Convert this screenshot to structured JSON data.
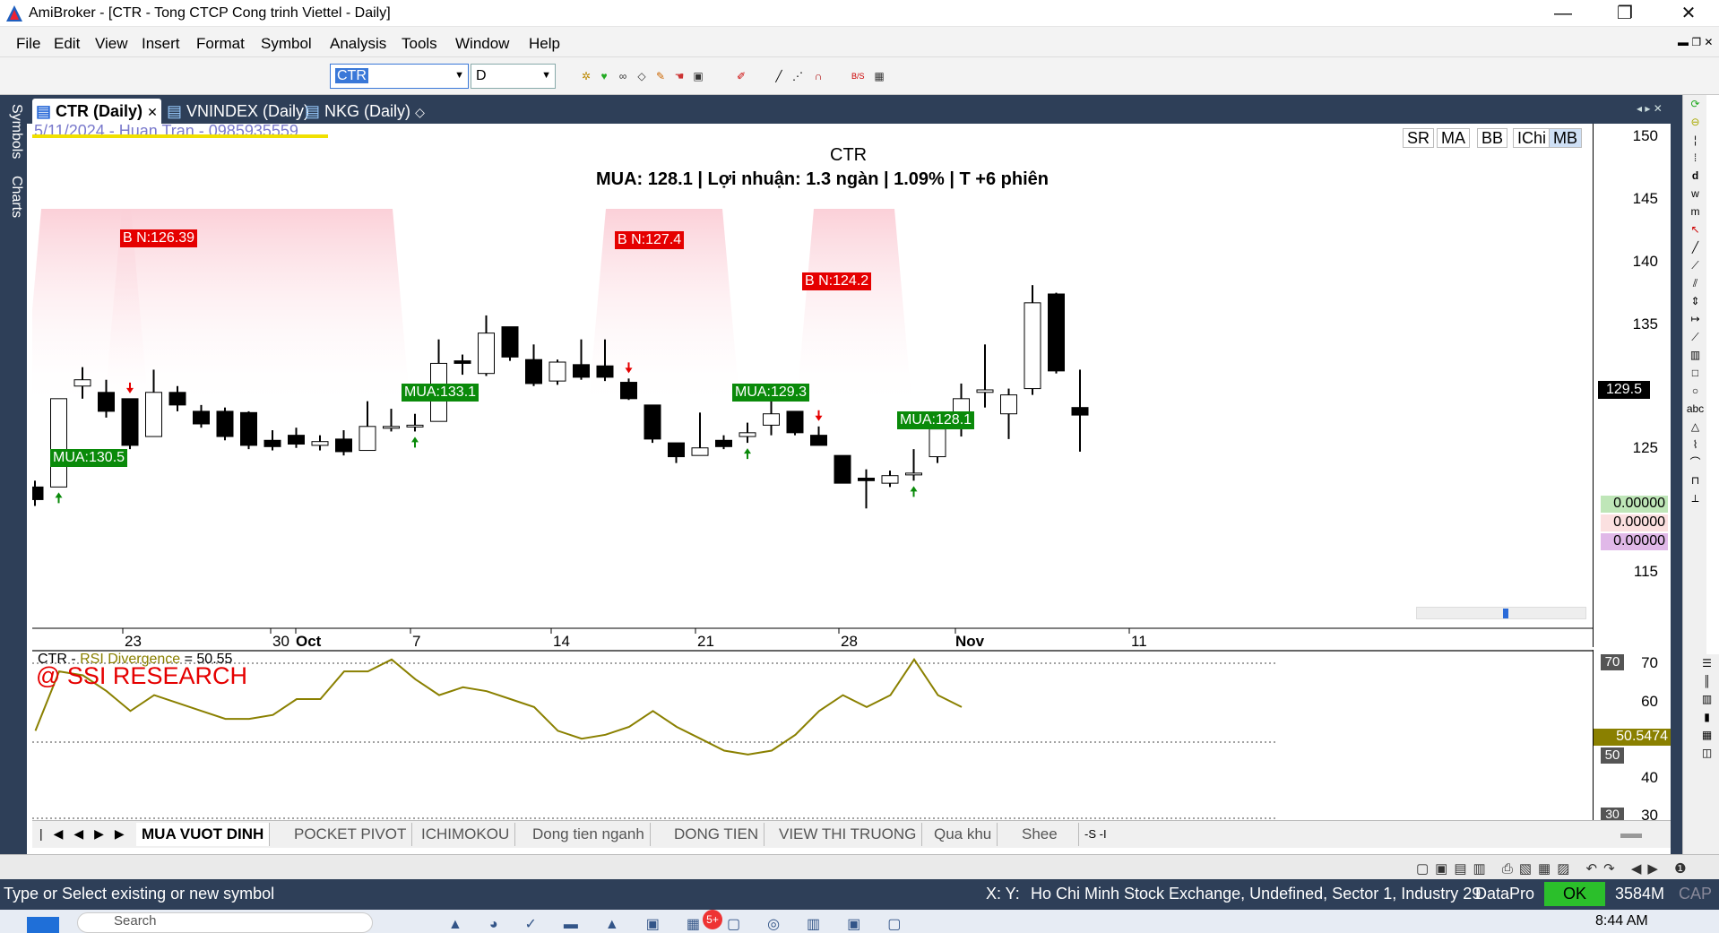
{
  "window": {
    "title": "AmiBroker - [CTR - Tong CTCP Cong trinh Viettel - Daily]",
    "minimize": "—",
    "restore": "❐",
    "close": "✕"
  },
  "menu": [
    "File",
    "Edit",
    "View",
    "Insert",
    "Format",
    "Symbol",
    "Analysis",
    "Tools",
    "Window",
    "Help"
  ],
  "toolbar": {
    "symbol_value": "CTR",
    "interval_value": "D"
  },
  "side_tabs": {
    "symbols": "Symbols",
    "charts": "Charts"
  },
  "doc_tabs": [
    {
      "label": "CTR (Daily)",
      "active": true
    },
    {
      "label": "VNINDEX (Daily)",
      "active": false
    },
    {
      "label": "NKG (Daily)",
      "active": false
    }
  ],
  "chart": {
    "watermark": "5/11/2024 - Huan Tran - 0985935559",
    "title": "CTR",
    "info": "MUA:  128.1  |  Lợi nhuận: 1.3 ngàn |  1.09%  |  T +6 phiên",
    "mode_buttons": [
      "SR",
      "MA",
      "BB",
      "IChi",
      "MB"
    ],
    "current_price": "129.5",
    "indicator_values": [
      "0.00000",
      "0.00000",
      "0.00000"
    ],
    "signals": [
      {
        "text": "MUA:130.5",
        "kind": "buy"
      },
      {
        "text": "B N:126.39",
        "kind": "sell"
      },
      {
        "text": "MUA:133.1",
        "kind": "buy"
      },
      {
        "text": "B N:127.4",
        "kind": "sell"
      },
      {
        "text": "MUA:129.3",
        "kind": "buy"
      },
      {
        "text": "B N:124.2",
        "kind": "sell"
      },
      {
        "text": "MUA:128.1",
        "kind": "buy"
      }
    ],
    "x_ticks": [
      "23",
      "30",
      "Oct",
      "7",
      "14",
      "21",
      "28",
      "Nov",
      "11"
    ],
    "y_ticks": [
      "150",
      "145",
      "140",
      "135",
      "125",
      "115"
    ]
  },
  "rsi": {
    "label_prefix": "CTR - ",
    "label_name": "RSI Divergence",
    "label_value": " = 50.55",
    "brand": "@ SSI RESEARCH",
    "value_box": "50.5474",
    "y_ticks": [
      "70",
      "60",
      "50",
      "40",
      "30"
    ],
    "y_boxes": [
      "70",
      "50",
      "30"
    ]
  },
  "sheets": [
    "MUA VUOT DINH",
    "POCKET PIVOT",
    "ICHIMOKOU",
    "Dong tien nganh",
    "DONG TIEN",
    "VIEW THI TRUONG",
    "Qua khu",
    "Shee"
  ],
  "status": {
    "hint": "Type or Select existing or new symbol",
    "xy": "X:  Y:",
    "exchange": "Ho Chi Minh Stock Exchange, Undefined, Sector 1, Industry 29",
    "source": "DataPro",
    "ok": "OK",
    "mem": "3584M",
    "cap": "CAP"
  },
  "taskbar": {
    "time": "8:44 AM",
    "search_placeholder": "Search"
  },
  "colors": {
    "frame": "#2e3f58",
    "bull": "#ffffff",
    "bear": "#000000",
    "rsi_line": "#8a8000",
    "sell": "#e50000",
    "buy": "#0a8a0a"
  },
  "chart_data": {
    "type": "candlestick",
    "title": "CTR",
    "candles": [
      {
        "o": 123.5,
        "h": 124,
        "l": 122,
        "c": 122.5
      },
      {
        "o": 123.5,
        "h": 130.5,
        "l": 123.5,
        "c": 130.5
      },
      {
        "o": 131.5,
        "h": 133,
        "l": 130.5,
        "c": 132
      },
      {
        "o": 131,
        "h": 132,
        "l": 129,
        "c": 129.5
      },
      {
        "o": 130.5,
        "h": 130.5,
        "l": 126.5,
        "c": 126.8
      },
      {
        "o": 127.5,
        "h": 132.8,
        "l": 127.5,
        "c": 131
      },
      {
        "o": 131,
        "h": 131.5,
        "l": 129.5,
        "c": 130
      },
      {
        "o": 129.5,
        "h": 130,
        "l": 128.2,
        "c": 128.5
      },
      {
        "o": 129.5,
        "h": 129.8,
        "l": 127.2,
        "c": 127.5
      },
      {
        "o": 129.4,
        "h": 129.5,
        "l": 126.5,
        "c": 126.8
      },
      {
        "o": 127.2,
        "h": 128,
        "l": 126.4,
        "c": 126.7
      },
      {
        "o": 127.6,
        "h": 128.2,
        "l": 126.6,
        "c": 126.9
      },
      {
        "o": 126.8,
        "h": 127.6,
        "l": 126.4,
        "c": 127.1
      },
      {
        "o": 127.3,
        "h": 128,
        "l": 126,
        "c": 126.3
      },
      {
        "o": 126.4,
        "h": 130.3,
        "l": 126.4,
        "c": 128.3
      },
      {
        "o": 128.3,
        "h": 129.7,
        "l": 127.9,
        "c": 128.3
      },
      {
        "o": 128.3,
        "h": 129.3,
        "l": 127.9,
        "c": 128.4
      },
      {
        "o": 128.7,
        "h": 135.2,
        "l": 128.7,
        "c": 133.3
      },
      {
        "o": 133.5,
        "h": 134,
        "l": 132.4,
        "c": 133.3
      },
      {
        "o": 132.5,
        "h": 137.1,
        "l": 132.3,
        "c": 135.7
      },
      {
        "o": 136.2,
        "h": 136.2,
        "l": 133.5,
        "c": 133.8
      },
      {
        "o": 133.6,
        "h": 134.8,
        "l": 131.5,
        "c": 131.7
      },
      {
        "o": 131.9,
        "h": 133.6,
        "l": 131.6,
        "c": 133.4
      },
      {
        "o": 133.2,
        "h": 135.2,
        "l": 132,
        "c": 132.2
      },
      {
        "o": 133.1,
        "h": 135.2,
        "l": 131.9,
        "c": 132.2
      },
      {
        "o": 131.8,
        "h": 132.1,
        "l": 130.4,
        "c": 130.5
      },
      {
        "o": 130,
        "h": 130,
        "l": 127,
        "c": 127.3
      },
      {
        "o": 127,
        "h": 127,
        "l": 125.4,
        "c": 125.9
      },
      {
        "o": 126,
        "h": 129.4,
        "l": 126,
        "c": 126.6
      },
      {
        "o": 127.2,
        "h": 127.6,
        "l": 126.5,
        "c": 126.7
      },
      {
        "o": 127.5,
        "h": 128.6,
        "l": 127,
        "c": 127.8
      },
      {
        "o": 128.4,
        "h": 131.5,
        "l": 127.6,
        "c": 129.3
      },
      {
        "o": 129.5,
        "h": 129.5,
        "l": 127.6,
        "c": 127.8
      },
      {
        "o": 127.6,
        "h": 128.3,
        "l": 126.8,
        "c": 126.8
      },
      {
        "o": 126,
        "h": 126,
        "l": 123.8,
        "c": 123.8
      },
      {
        "o": 124.2,
        "h": 124.9,
        "l": 121.8,
        "c": 124
      },
      {
        "o": 123.8,
        "h": 124.8,
        "l": 123.5,
        "c": 124.4
      },
      {
        "o": 124.5,
        "h": 126.5,
        "l": 124,
        "c": 124.6
      },
      {
        "o": 125.9,
        "h": 129.4,
        "l": 125.4,
        "c": 128.1
      },
      {
        "o": 128.4,
        "h": 131.7,
        "l": 127.5,
        "c": 130.5
      },
      {
        "o": 131,
        "h": 134.8,
        "l": 129.8,
        "c": 131.2
      },
      {
        "o": 129.3,
        "h": 131.3,
        "l": 127.3,
        "c": 130.8
      },
      {
        "o": 131.3,
        "h": 139.5,
        "l": 130.8,
        "c": 138.1
      },
      {
        "o": 138.8,
        "h": 138.9,
        "l": 132.5,
        "c": 132.7
      },
      {
        "o": 129.8,
        "h": 132.8,
        "l": 126.3,
        "c": 129.2
      }
    ],
    "ylim": [
      112.3,
      152.3
    ],
    "rsi": [
      52,
      67,
      66,
      62,
      57,
      61,
      59,
      57,
      55,
      55,
      56,
      60,
      60,
      67,
      67,
      70,
      65,
      61,
      63,
      62,
      60,
      58,
      52,
      50,
      51,
      53,
      57,
      53,
      50,
      47,
      46,
      47,
      51,
      57,
      61,
      58,
      61,
      70,
      61,
      58
    ],
    "rsi_ylim": [
      29,
      72
    ]
  }
}
